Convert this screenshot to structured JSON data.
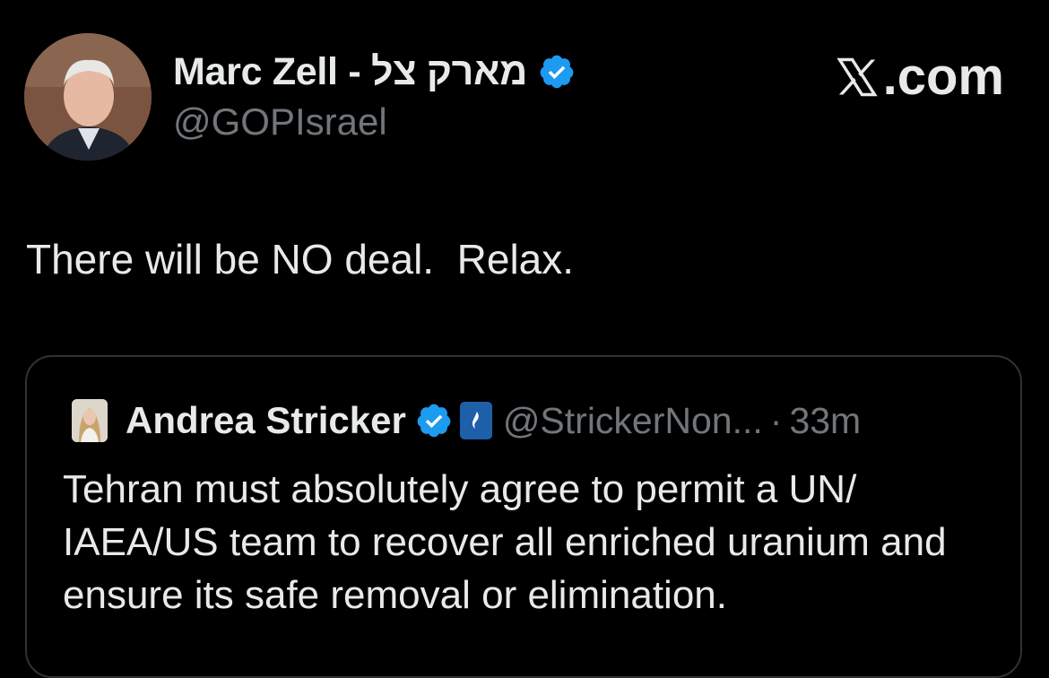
{
  "tweet": {
    "author": {
      "display_name": "Marc Zell - מארק צל",
      "handle": "@GOPIsrael",
      "verified_icon": "verified-badge-icon",
      "accent_color": "#1d9bf0"
    },
    "text": "There will be NO deal.  Relax."
  },
  "watermark": {
    "logo": "x-logo-icon",
    "text": ".com"
  },
  "quoted_tweet": {
    "author": {
      "display_name": "Andrea Stricker",
      "handle": "@StrickerNon...",
      "verified_icon": "verified-badge-icon",
      "affiliation_icon": "affiliation-badge-icon"
    },
    "separator": "·",
    "time": "33m",
    "text": "Tehran must absolutely agree to permit a UN/ IAEA/US team to recover all enriched uranium and ensure its safe removal or elimination."
  },
  "colors": {
    "background": "#000000",
    "text_primary": "#e7e9ea",
    "text_secondary": "#71767b",
    "border": "#2f3336",
    "verified": "#1d9bf0"
  }
}
